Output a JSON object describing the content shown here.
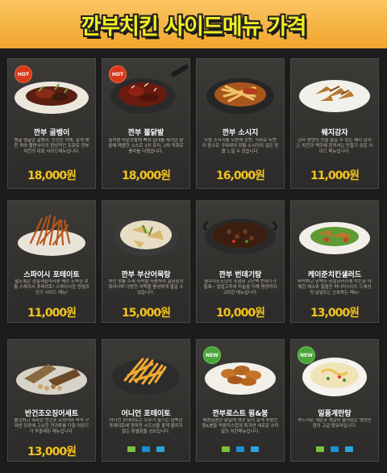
{
  "header": {
    "title": "깐부치킨 사이드메뉴 가격"
  },
  "colors": {
    "banner": "#f7b23d",
    "title": "#f2ef1e",
    "price": "#f4c41e",
    "hot": "#d8391b",
    "new": "#49a63a"
  },
  "items": [
    {
      "name": "깐부 골뱅이",
      "desc": "탱글 탱글한 골뱅이, 신선한 야채, 알게 채친 파와 쫄면사리의 환상적인 조화로 깐부치킨의 대표 사이드메뉴입니다.",
      "price": "18,000원",
      "badge": "HOT"
    },
    {
      "name": "깐부 불닭발",
      "desc": "실처럼 비운맛발에 뼈와 딥대를 제거한 닭발에 매콤한 소스로 1차 조리, 2차 직화로 풍미를 더했습니다.",
      "price": "18,000원",
      "badge": "HOT"
    },
    {
      "name": "깐부 소시지",
      "desc": "모듬 소시지를 오븐에 한번, 직화로 두번 이 중으로 구워내어 정통 소시지의 깊은 맛을 느낄 수 있습니다.",
      "price": "16,000원",
      "badge": ""
    },
    {
      "name": "웨지감자",
      "desc": "감자 본연의 맛을 즐길 수 있는 웨지 감자는 치킨과 맥주에 환적서는 만들기 쉬운 사이드 메뉴입니다.",
      "price": "11,000원",
      "badge": ""
    },
    {
      "name": "스파이시 포테이토",
      "desc": "얇도록은 감칠게찹미리편 매주 도독한 보통 스파이시 포테이토! 스파이시한 양념의 인기 사이드 메뉴!",
      "price": "11,000원",
      "badge": ""
    },
    {
      "name": "깐부 부산어묵탕",
      "desc": "부산 정통 수제 어묵을 사용하여 깔끔함이 뛰어나며 다양한 어묵을 풍성하게 즐길 수 있습니다.",
      "price": "15,000원",
      "badge": ""
    },
    {
      "name": "깐부 번데기탕",
      "desc": "월수이노노년의 포함된 고단백 번데기가 들록~ 칼칼고추와 마늘을 더해 명양까지 고려한 메뉴입니다.",
      "price": "10,000원",
      "badge": ""
    },
    {
      "name": "케이준치킨샐러드",
      "desc": "바삭하고 담백한 공살코리스에 치킨과 야채한 채소와 칠쓸한 허니머스터드 드레싱의 날넘도는 신호하는 메뉴!",
      "price": "13,000원",
      "badge": ""
    },
    {
      "name": "반건조오징어세트",
      "desc": "쫄깃하고 촉촉한 반건조 오징어와 바삭 구워낸 쥐포에 고소한 견과류를 다함 아몬드가 추들래된 메뉴입니다.",
      "price": "13,000원",
      "badge": ""
    },
    {
      "name": "어니언 포테이토",
      "desc": "어니언 포테이토는 오우가 즐기는 담백한 포테이토에 양파맛 시즈닝을 쌓게 볼리지 않는 특별함을 선보입니다.",
      "price": "",
      "badge": ""
    },
    {
      "name": "깐부로스트 윙&봉",
      "desc": "매콤달콤한 닭날에 깨끗 닭의 날개 부분인 윙&봉을 먹음직스럽게 튀겨낸 새로운 스타일의 치킨메뉴입니다.",
      "price": "",
      "badge": "NEW"
    },
    {
      "name": "일품계란탕",
      "desc": "부드러운 계란과 계살이 들어있는 영양만점의 고급 탕요리입니다.",
      "price": "",
      "badge": "NEW"
    }
  ],
  "social_icons": [
    "share-icon",
    "twitter-icon",
    "facebook-icon"
  ]
}
